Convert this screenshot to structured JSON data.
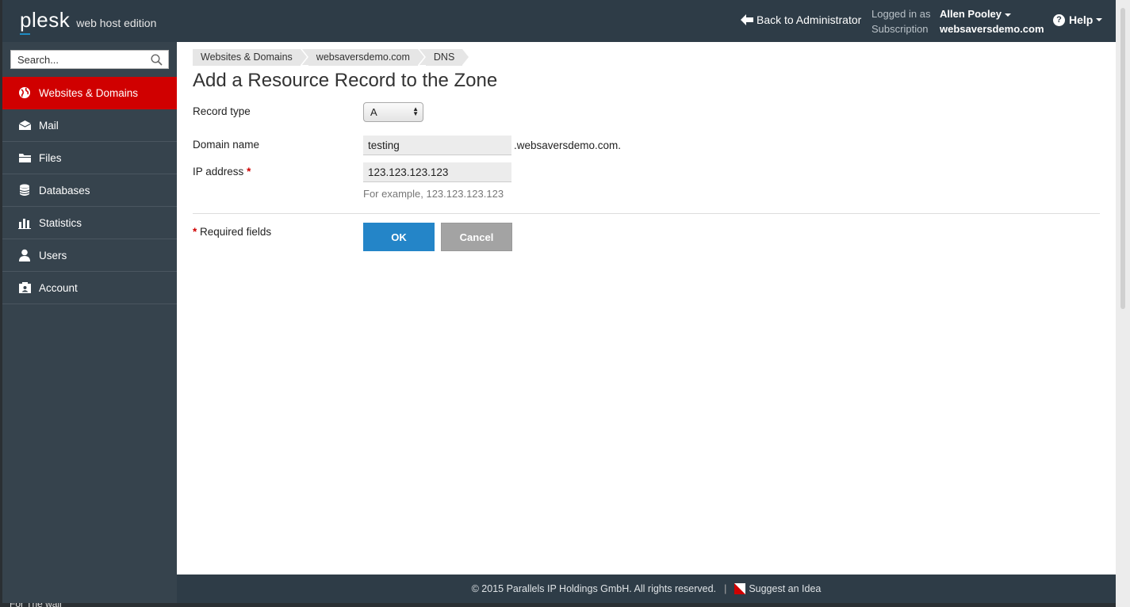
{
  "header": {
    "logo_name": "plesk",
    "logo_edition": "web host edition",
    "back_label": "Back to Administrator",
    "logged_in_label": "Logged in as",
    "logged_in_user": "Allen Pooley",
    "subscription_label": "Subscription",
    "subscription_value": "websaversdemo.com",
    "help_label": "Help"
  },
  "sidebar": {
    "search_placeholder": "Search...",
    "items": [
      {
        "label": "Websites & Domains",
        "icon": "globe-icon",
        "active": true
      },
      {
        "label": "Mail",
        "icon": "mail-icon"
      },
      {
        "label": "Files",
        "icon": "folder-icon"
      },
      {
        "label": "Databases",
        "icon": "database-icon"
      },
      {
        "label": "Statistics",
        "icon": "chart-icon"
      },
      {
        "label": "Users",
        "icon": "user-icon"
      },
      {
        "label": "Account",
        "icon": "account-icon"
      }
    ]
  },
  "breadcrumb": [
    "Websites & Domains",
    "websaversdemo.com",
    "DNS"
  ],
  "page": {
    "title": "Add a Resource Record to the Zone"
  },
  "form": {
    "record_type_label": "Record type",
    "record_type_value": "A",
    "domain_name_label": "Domain name",
    "domain_name_value": "testing",
    "domain_suffix": ".websaversdemo.com.",
    "ip_label": "IP address",
    "required_marker": "*",
    "ip_value": "123.123.123.123",
    "ip_hint": "For example, 123.123.123.123",
    "required_fields": "Required fields",
    "ok_label": "OK",
    "cancel_label": "Cancel"
  },
  "footer": {
    "copyright": "© 2015 Parallels IP Holdings GmbH. All rights reserved.",
    "separator": "|",
    "suggest": "Suggest an Idea"
  },
  "desktop": {
    "partial_text": "For The wall"
  },
  "colors": {
    "header_bg": "#2e3c47",
    "sidebar_bg": "#36434d",
    "active_item": "#d00000",
    "ok_button": "#2485c8",
    "cancel_button": "#a3a3a3"
  }
}
